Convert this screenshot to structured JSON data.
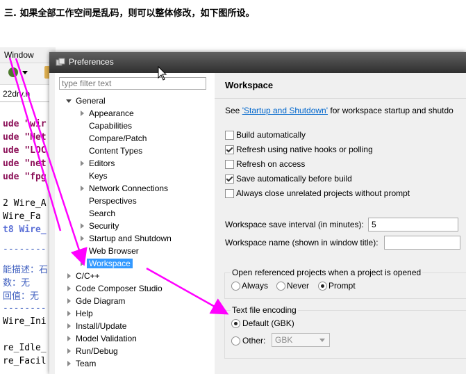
{
  "heading": "三. 如果全部工作空间是乱码，则可以整体修改，如下图所设。",
  "background_window": {
    "menu": "Window",
    "tab": "22drv.h",
    "code_lines": [
      {
        "kind": "include",
        "prefix": "ude ",
        "text": "\"wir"
      },
      {
        "kind": "include",
        "prefix": "ude ",
        "text": "\"Net"
      },
      {
        "kind": "include",
        "prefix": "ude ",
        "text": "\"LOC"
      },
      {
        "kind": "include",
        "prefix": "ude ",
        "text": "\"net"
      },
      {
        "kind": "include",
        "prefix": "ude ",
        "text": "\"fpg"
      },
      {
        "kind": "plain",
        "text": "2 Wire_A"
      },
      {
        "kind": "plain",
        "text": " Wire_Fa"
      },
      {
        "kind": "blue",
        "text": "t8 Wire_"
      },
      {
        "kind": "dash",
        "text": "--------"
      },
      {
        "kind": "comment",
        "text": "能描述：石"
      },
      {
        "kind": "comment",
        "text": "数：无"
      },
      {
        "kind": "comment",
        "text": "回值：无"
      },
      {
        "kind": "dash",
        "text": "--------"
      },
      {
        "kind": "plain",
        "text": "Wire_Ini"
      },
      {
        "kind": "plain",
        "text": "re_Idle_"
      },
      {
        "kind": "plain",
        "text": "re_Facil"
      }
    ]
  },
  "dialog": {
    "title": "Preferences",
    "filter_placeholder": "type filter text",
    "tree": {
      "general": "General",
      "general_children": [
        "Appearance",
        "Capabilities",
        "Compare/Patch",
        "Content Types",
        "Editors",
        "Keys",
        "Network Connections",
        "Perspectives",
        "Search",
        "Security",
        "Startup and Shutdown",
        "Web Browser",
        "Workspace"
      ],
      "top_level": [
        "C/C++",
        "Code Composer Studio",
        "Gde Diagram",
        "Help",
        "Install/Update",
        "Model Validation",
        "Run/Debug",
        "Team"
      ]
    },
    "page": {
      "title": "Workspace",
      "see_prefix": "See ",
      "see_link": "'Startup and Shutdown'",
      "see_suffix": " for workspace startup and shutdo",
      "checkboxes": [
        {
          "label": "Build automatically",
          "checked": false
        },
        {
          "label": "Refresh using native hooks or polling",
          "checked": true
        },
        {
          "label": "Refresh on access",
          "checked": false
        },
        {
          "label": "Save automatically before build",
          "checked": true
        },
        {
          "label": "Always close unrelated projects without prompt",
          "checked": false
        }
      ],
      "save_interval_label": "Workspace save interval (in minutes):",
      "save_interval_value": "5",
      "workspace_name_label": "Workspace name (shown in window title):",
      "workspace_name_value": "",
      "open_projects": {
        "label": "Open referenced projects when a project is opened",
        "options": [
          "Always",
          "Never",
          "Prompt"
        ],
        "selected": "Prompt"
      },
      "encoding": {
        "label": "Text file encoding",
        "default_label": "Default (GBK)",
        "other_label": "Other:",
        "other_value": "GBK",
        "selected": "Default (GBK)"
      }
    }
  },
  "annotation_color": "#ff00ff"
}
